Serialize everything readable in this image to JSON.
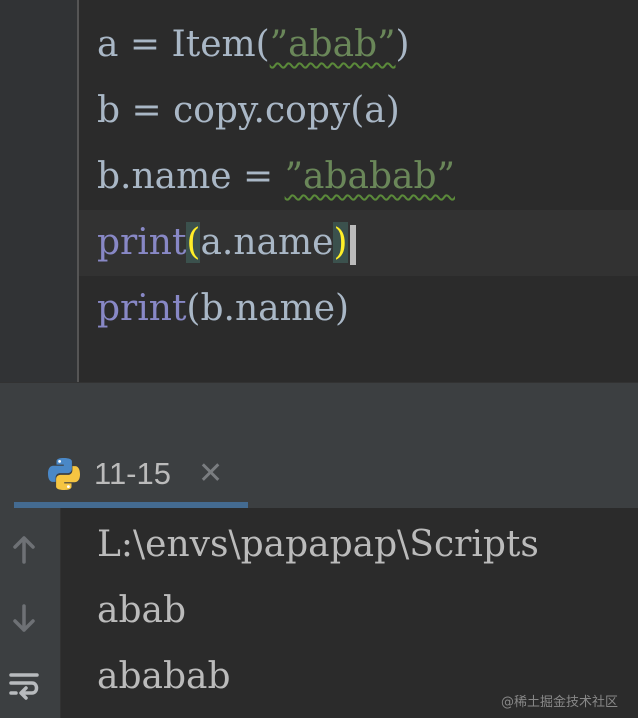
{
  "editor": {
    "lines": [
      {
        "pre": "a = Item(",
        "str": "”abab”",
        "post": ")"
      },
      {
        "text": "b = copy.copy(a)"
      },
      {
        "pre": "b.name = ",
        "str": "”ababab”"
      },
      {
        "fn": "print",
        "open": "(",
        "arg": "a.name",
        "close": ")"
      },
      {
        "fn": "print",
        "rest": "(b.name)"
      }
    ]
  },
  "run_panel": {
    "tab_label": "11-15",
    "close_glyph": "✕",
    "icons": [
      "python-icon",
      "arrow-up-icon",
      "arrow-down-icon",
      "soft-wrap-icon"
    ]
  },
  "console": {
    "lines": [
      "L:\\envs\\papapap\\Scripts",
      "abab",
      "ababab"
    ]
  },
  "watermark": "@稀土掘金技术社区",
  "colors": {
    "editor_bg": "#2b2b2b",
    "gutter_bg": "#313335",
    "string": "#6a8759",
    "builtin": "#8888c6",
    "text": "#a9b7c6",
    "brace_match": "#ffef28"
  }
}
